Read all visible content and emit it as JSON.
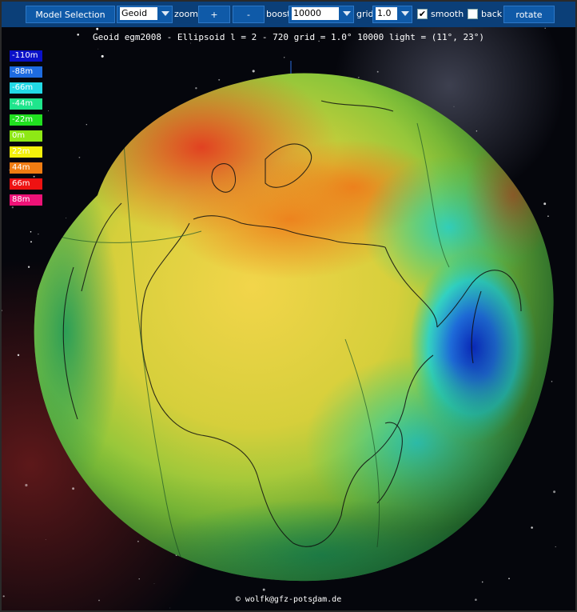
{
  "toolbar": {
    "model_selection_label": "Model Selection",
    "model_value": "Geoid",
    "zoom_label": "zoom",
    "zoom_in_label": "+",
    "zoom_out_label": "-",
    "boost_label": "boost",
    "boost_value": "10000",
    "grid_label": "grid",
    "grid_value": "1.0",
    "smooth_label": "smooth",
    "smooth_checked": true,
    "back_label": "back",
    "back_checked": false,
    "rotate_label": "rotate"
  },
  "status_line": "Geoid egm2008 - Ellipsoid l = 2 - 720 grid = 1.0° 10000 light = (11°, 23°)",
  "legend": [
    {
      "label": "-110m",
      "color": "#0a10c8"
    },
    {
      "label": "-88m",
      "color": "#1e6be0"
    },
    {
      "label": "-66m",
      "color": "#22d9e6"
    },
    {
      "label": "-44m",
      "color": "#1fe58c"
    },
    {
      "label": "-22m",
      "color": "#21e020"
    },
    {
      "label": "0m",
      "color": "#8ee815"
    },
    {
      "label": "22m",
      "color": "#f3f00b"
    },
    {
      "label": "44m",
      "color": "#f07c12"
    },
    {
      "label": "66m",
      "color": "#ee1212"
    },
    {
      "label": "88m",
      "color": "#ee1277"
    }
  ],
  "credit": "© wolfk@gfz-potsdam.de"
}
